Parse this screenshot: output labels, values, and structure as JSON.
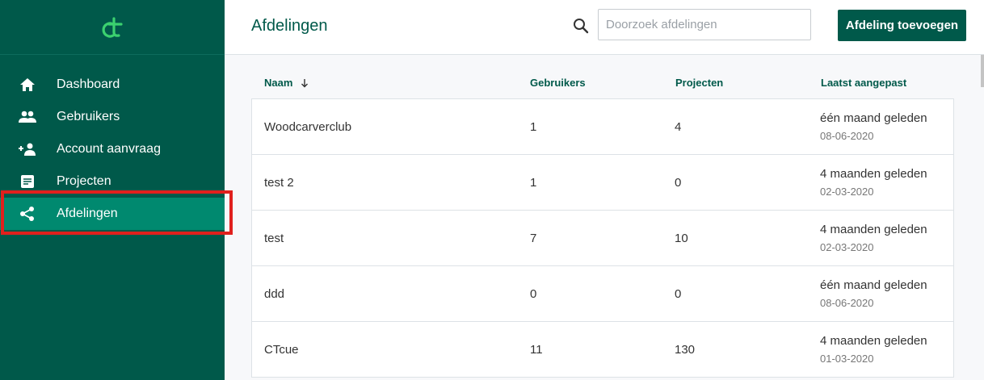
{
  "sidebar": {
    "items": [
      {
        "label": "Dashboard",
        "icon": "home-icon",
        "active": false
      },
      {
        "label": "Gebruikers",
        "icon": "users-icon",
        "active": false
      },
      {
        "label": "Account aanvraag",
        "icon": "add-user-icon",
        "active": false
      },
      {
        "label": "Projecten",
        "icon": "document-icon",
        "active": false
      },
      {
        "label": "Afdelingen",
        "icon": "share-icon",
        "active": true
      }
    ]
  },
  "header": {
    "title": "Afdelingen",
    "search_placeholder": "Doorzoek afdelingen",
    "add_button_label": "Afdeling toevoegen"
  },
  "table": {
    "columns": {
      "name": "Naam",
      "users": "Gebruikers",
      "projects": "Projecten",
      "modified": "Laatst aangepast"
    },
    "rows": [
      {
        "name": "Woodcarverclub",
        "users": "1",
        "projects": "4",
        "relative": "één maand geleden",
        "date": "08-06-2020"
      },
      {
        "name": "test 2",
        "users": "1",
        "projects": "0",
        "relative": "4 maanden geleden",
        "date": "02-03-2020"
      },
      {
        "name": "test",
        "users": "7",
        "projects": "10",
        "relative": "4 maanden geleden",
        "date": "02-03-2020"
      },
      {
        "name": "ddd",
        "users": "0",
        "projects": "0",
        "relative": "één maand geleden",
        "date": "08-06-2020"
      },
      {
        "name": "CTcue",
        "users": "11",
        "projects": "130",
        "relative": "4 maanden geleden",
        "date": "01-03-2020"
      }
    ]
  },
  "colors": {
    "brand": "#00594a",
    "active": "#00896f",
    "logo": "#3bd16f",
    "highlight": "#e0201d"
  }
}
